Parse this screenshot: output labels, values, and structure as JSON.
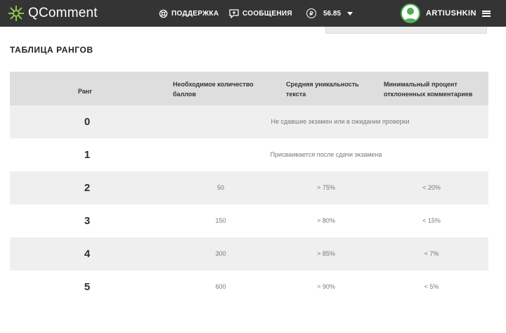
{
  "header": {
    "logo_text": "QComment",
    "nav": {
      "support_label": "ПОДДЕРЖКА",
      "messages_label": "СООБЩЕНИЯ"
    },
    "balance": {
      "currency_symbol": "₽",
      "amount": "56.85"
    },
    "user": {
      "username": "ARTIUSHKIN"
    }
  },
  "page": {
    "title": "ТАБЛИЦА РАНГОВ"
  },
  "table": {
    "headers": {
      "rank": "Ранг",
      "points": "Необходимое количество баллов",
      "uniqueness": "Средняя уникальность текста",
      "rejected": "Минимальный процент отклоненных комментариев"
    },
    "rows": [
      {
        "rank": "0",
        "note": "Не сдавшие экзамен или в ожидании проверки"
      },
      {
        "rank": "1",
        "note": "Присваивается после сдачи экзамена"
      },
      {
        "rank": "2",
        "points": "50",
        "uniqueness": "> 75%",
        "rejected": "< 20%"
      },
      {
        "rank": "3",
        "points": "150",
        "uniqueness": "> 80%",
        "rejected": "< 15%"
      },
      {
        "rank": "4",
        "points": "300",
        "uniqueness": "> 85%",
        "rejected": "< 7%"
      },
      {
        "rank": "5",
        "points": "600",
        "uniqueness": "> 90%",
        "rejected": "< 5%"
      }
    ]
  },
  "colors": {
    "topbar": "#343434",
    "header_row": "#dedede",
    "shaded_row": "#efefef",
    "logo_green": "#8bc34a",
    "avatar_ring": "#4caf50"
  },
  "icons": {
    "logo": "qcomment-logo-icon",
    "support": "lifebuoy-icon",
    "messages": "chat-plus-icon",
    "balance": "ruble-coin-icon",
    "balance_caret": "chevron-down-icon",
    "menu": "hamburger-menu-icon"
  }
}
